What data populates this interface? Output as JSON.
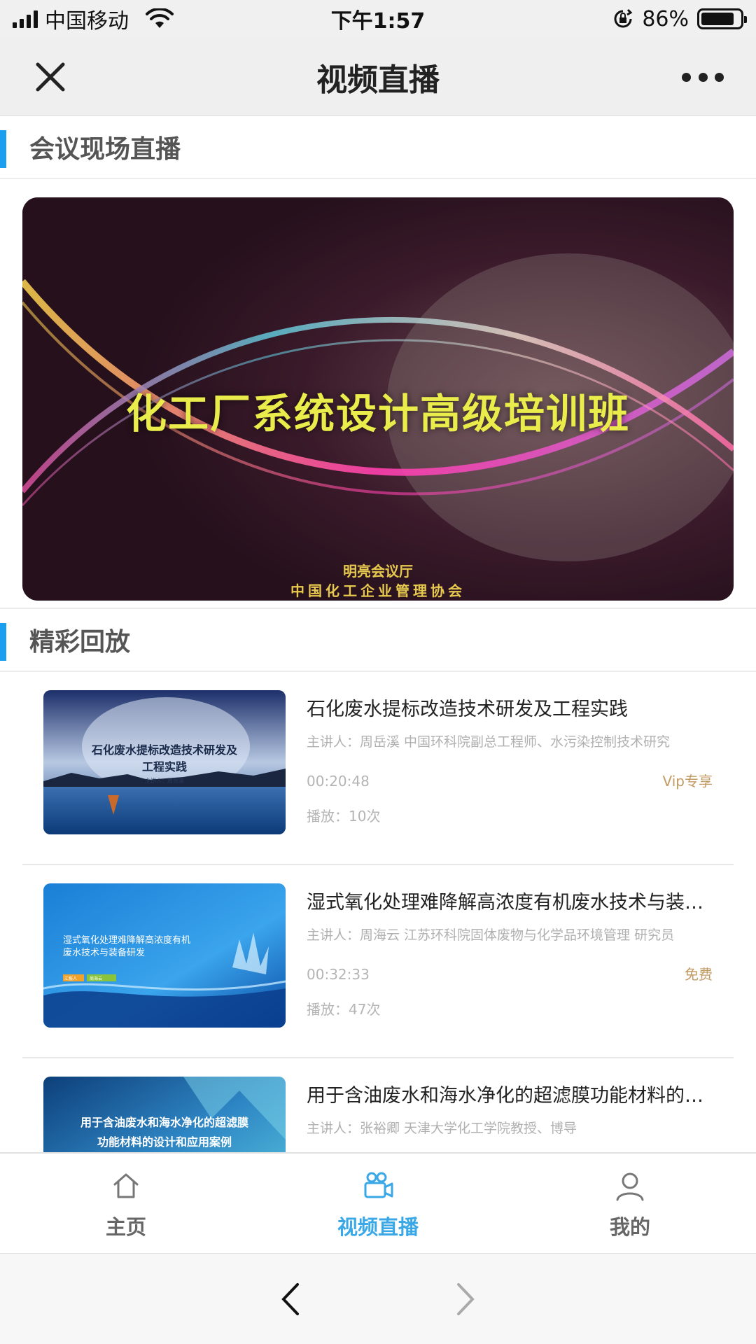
{
  "status_bar": {
    "carrier": "中国移动",
    "time": "下午1:57",
    "battery": "86%",
    "battery_level": 0.86
  },
  "nav": {
    "title": "视频直播",
    "close_icon": "close-icon",
    "more_icon": "more-dots-icon"
  },
  "live_section": {
    "title": "会议现场直播",
    "banner": {
      "title": "化工厂系统设计高级培训班",
      "venue": "明亮会议厅",
      "organizer": "中国化工企业管理协会"
    }
  },
  "replay_section": {
    "title": "精彩回放",
    "videos": [
      {
        "title": "石化废水提标改造技术研发及工程实践",
        "speaker": "主讲人：周岳溪 中国环科院副总工程师、水污染控制技术研究",
        "duration": "00:20:48",
        "tag": "Vip专享",
        "plays": "播放：10次",
        "thumb_line1": "石化废水提标改造技术研发及",
        "thumb_line2": "工程实践",
        "thumb_sub": "主讲人：周岳溪"
      },
      {
        "title": "湿式氧化处理难降解高浓度有机废水技术与装备研发",
        "speaker": "主讲人：周海云 江苏环科院固体废物与化学品环境管理 研究员",
        "duration": "00:32:33",
        "tag": "免费",
        "plays": "播放：47次",
        "thumb_line1": "湿式氧化处理难降解高浓度有机",
        "thumb_line2": "废水技术与装备研发",
        "thumb_sub": "汇报人",
        "thumb_sub2": "周海云"
      },
      {
        "title": "用于含油废水和海水净化的超滤膜功能材料的设计和应用案例",
        "speaker": "主讲人：张裕卿 天津大学化工学院教授、博导",
        "thumb_line1": "用于含油废水和海水净化的超滤膜",
        "thumb_line2": "功能材料的设计和应用案例"
      }
    ]
  },
  "tab_bar": {
    "tabs": [
      {
        "label": "主页",
        "icon": "home-icon",
        "active": false
      },
      {
        "label": "视频直播",
        "icon": "video-camera-icon",
        "active": true
      },
      {
        "label": "我的",
        "icon": "user-icon",
        "active": false
      }
    ]
  },
  "browser": {
    "back_icon": "chevron-left-icon",
    "forward_icon": "chevron-right-icon"
  },
  "colors": {
    "accent": "#1a9ff0",
    "active_tab": "#3aa8e6",
    "tag": "#c29a62",
    "banner_title": "#e9ec4a"
  }
}
